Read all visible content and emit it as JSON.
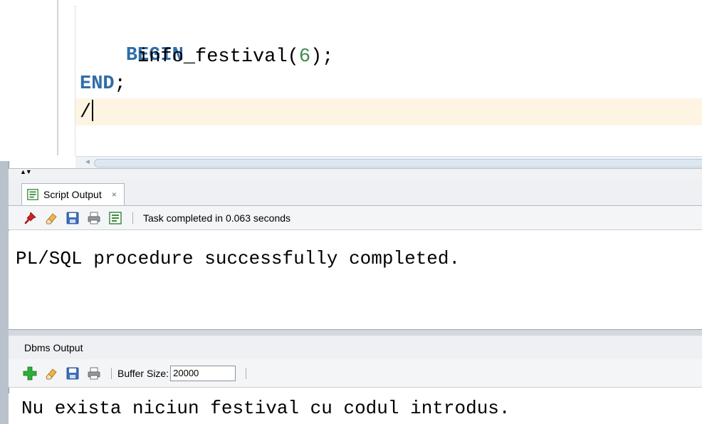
{
  "editor": {
    "lines": {
      "l1_kw": "BEGIN",
      "l2_indent": "     ",
      "l2_name": "info_festival(",
      "l2_num": "6",
      "l2_end": ");",
      "l3_kw": "END",
      "l3_end": ";",
      "l4": "/"
    }
  },
  "script_output": {
    "tab_label": "Script Output",
    "tab_close": "×",
    "status": "Task completed in 0.063 seconds",
    "text": "PL/SQL procedure successfully completed.",
    "toolbar_icons": [
      "pin-icon",
      "eraser-icon",
      "save-icon",
      "print-icon",
      "script-icon"
    ]
  },
  "dbms_output": {
    "title": "Dbms Output",
    "buffer_label": "Buffer Size:",
    "buffer_value": "20000",
    "text": "Nu exista niciun festival cu codul introdus.",
    "toolbar_icons": [
      "add-icon",
      "eraser-icon",
      "save-icon",
      "print-icon"
    ]
  },
  "colors": {
    "keyword": "#2f6ea8",
    "number": "#3d8c4b",
    "current_line": "#fdf5e2"
  }
}
